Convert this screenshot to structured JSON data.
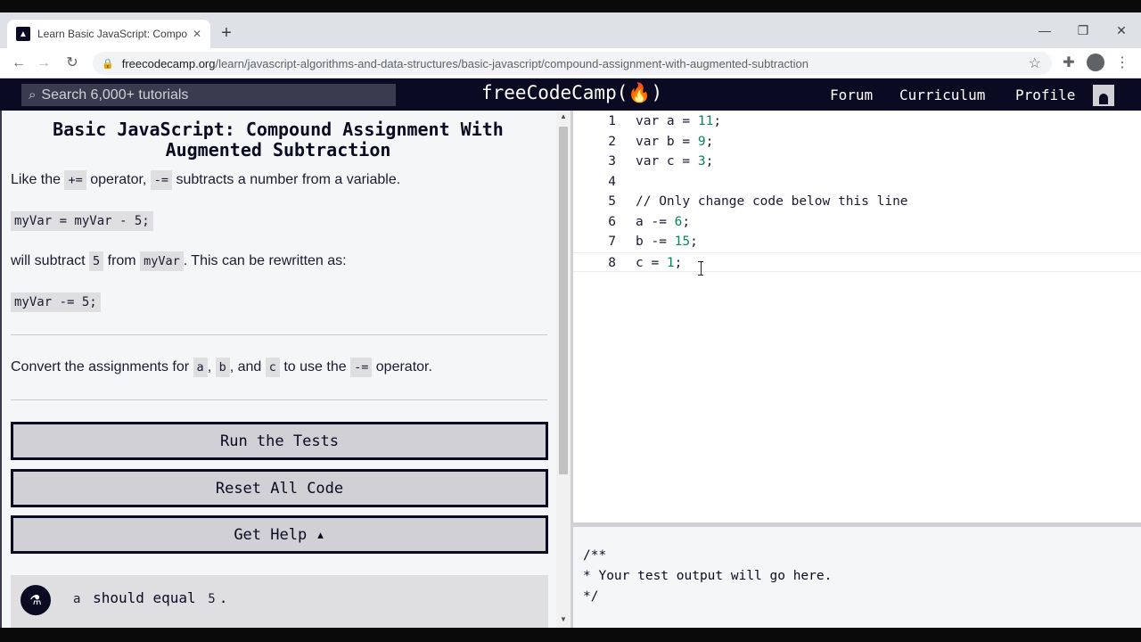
{
  "browser": {
    "tab_title": "Learn Basic JavaScript: Compound Assignment With Augmented Subtraction",
    "tab_close": "✕",
    "url_domain": "freecodecamp.org",
    "url_path": "/learn/javascript-algorithms-and-data-structures/basic-javascript/compound-assignment-with-augmented-subtraction"
  },
  "nav": {
    "search_placeholder": "Search 6,000+ tutorials",
    "logo": "freeCodeCamp(🔥)",
    "links": [
      "Forum",
      "Curriculum",
      "Profile"
    ]
  },
  "lesson": {
    "title": "Basic JavaScript: Compound Assignment With Augmented Subtraction",
    "p1_pre": "Like the ",
    "p1_code1": "+=",
    "p1_mid": " operator, ",
    "p1_code2": "-=",
    "p1_post": " subtracts a number from a variable.",
    "code1": "myVar = myVar - 5;",
    "p2_pre": "will subtract ",
    "p2_code1": "5",
    "p2_mid": " from ",
    "p2_code2": "myVar",
    "p2_post": ". This can be rewritten as:",
    "code2": "myVar -= 5;",
    "p3_pre": "Convert the assignments for ",
    "p3_a": "a",
    "p3_sep1": ", ",
    "p3_b": "b",
    "p3_sep2": ", and ",
    "p3_c": "c",
    "p3_mid": " to use the ",
    "p3_op": "-=",
    "p3_post": " operator."
  },
  "buttons": {
    "run": "Run the Tests",
    "reset": "Reset All Code",
    "help": "Get Help ▴"
  },
  "test": {
    "var": "a",
    "text": " should equal ",
    "value": "5",
    "end": "."
  },
  "editor": {
    "lines": [
      {
        "n": "1",
        "pre": "var a = ",
        "num": "11",
        "post": ";"
      },
      {
        "n": "2",
        "pre": "var b = ",
        "num": "9",
        "post": ";"
      },
      {
        "n": "3",
        "pre": "var c = ",
        "num": "3",
        "post": ";"
      },
      {
        "n": "4",
        "pre": "",
        "num": "",
        "post": ""
      },
      {
        "n": "5",
        "comment": "// Only change code below this line"
      },
      {
        "n": "6",
        "pre": "a -= ",
        "num": "6",
        "post": ";"
      },
      {
        "n": "7",
        "pre": "b -= ",
        "num": "15",
        "post": ";"
      },
      {
        "n": "8",
        "pre": "c = ",
        "num": "1",
        "post": ";"
      }
    ]
  },
  "output": {
    "lines": [
      "/**",
      "* Your test output will go here.",
      "*/"
    ]
  }
}
